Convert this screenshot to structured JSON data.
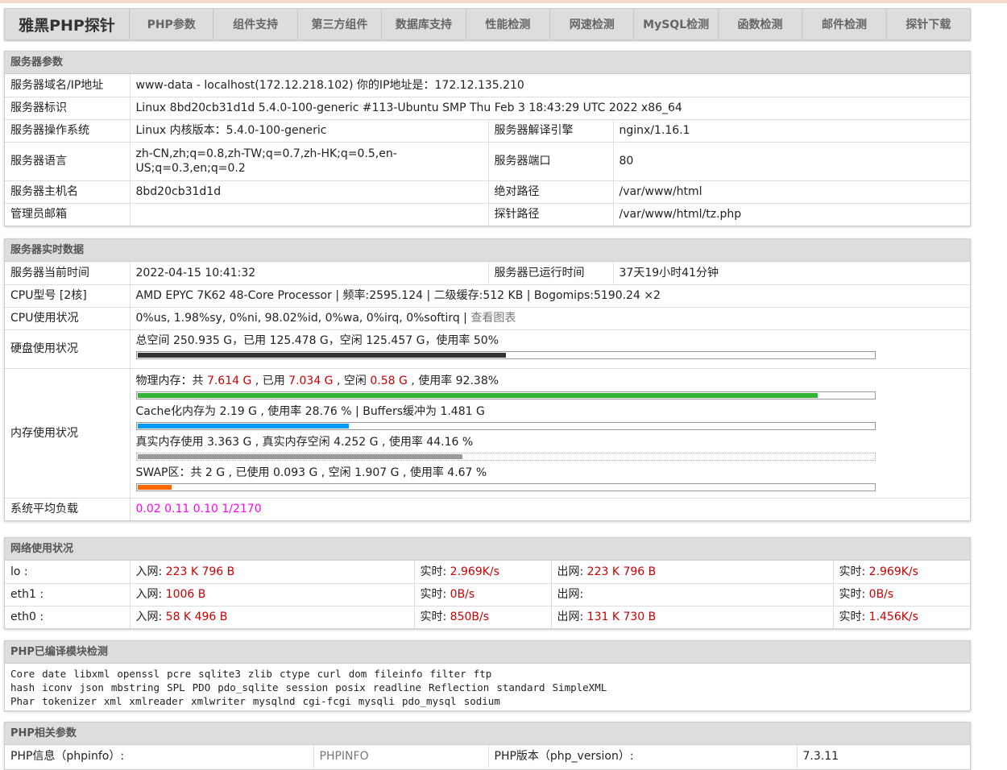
{
  "nav": {
    "logo": "雅黑PHP探针",
    "items": [
      "PHP参数",
      "组件支持",
      "第三方组件",
      "数据库支持",
      "性能检测",
      "网速检测",
      "MySQL检测",
      "函数检测",
      "邮件检测",
      "探针下载"
    ]
  },
  "server": {
    "title": "服务器参数",
    "rows": [
      [
        {
          "t": "服务器域名/IP地址"
        },
        {
          "t": "www-data - localhost(172.12.218.102)  你的IP地址是：172.12.135.210",
          "span": 3
        }
      ],
      [
        {
          "t": "服务器标识"
        },
        {
          "t": "Linux 8bd20cb31d1d 5.4.0-100-generic #113-Ubuntu SMP Thu Feb 3 18:43:29 UTC 2022 x86_64",
          "span": 3
        }
      ],
      [
        {
          "t": "服务器操作系统"
        },
        {
          "t": "Linux  内核版本：5.4.0-100-generic"
        },
        {
          "t": "服务器解译引擎"
        },
        {
          "t": "nginx/1.16.1"
        }
      ],
      [
        {
          "t": "服务器语言"
        },
        {
          "t": "zh-CN,zh;q=0.8,zh-TW;q=0.7,zh-HK;q=0.5,en-US;q=0.3,en;q=0.2"
        },
        {
          "t": "服务器端口"
        },
        {
          "t": "80"
        }
      ],
      [
        {
          "t": "服务器主机名"
        },
        {
          "t": "8bd20cb31d1d"
        },
        {
          "t": "绝对路径"
        },
        {
          "t": "/var/www/html"
        }
      ],
      [
        {
          "t": "管理员邮箱"
        },
        {
          "t": ""
        },
        {
          "t": "探针路径"
        },
        {
          "t": "/var/www/html/tz.php"
        }
      ]
    ]
  },
  "realtime": {
    "title": "服务器实时数据",
    "time_label": "服务器当前时间",
    "time": "2022-04-15 10:41:32",
    "uptime_label": "服务器已运行时间",
    "uptime": "37天19小时41分钟",
    "cpu_label": "CPU型号 [2核]",
    "cpu": "AMD EPYC 7K62 48-Core Processor | 频率:2595.124 | 二级缓存:512 KB | Bogomips:5190.24 ×2",
    "cpu_usage_label": "CPU使用状况",
    "cpu_usage": "0%us, 1.98%sy, 0%ni, 98.02%id, 0%wa, 0%irq, 0%softirq | ",
    "cpu_chart_link": "查看图表",
    "disk_label": "硬盘使用状况",
    "disk": "总空间 250.935 G，已用 125.478 G，空闲 125.457 G，使用率 50%",
    "disk_pct": 50,
    "mem_label": "内存使用状况",
    "mem": [
      {
        "parts": [
          {
            "t": "物理内存：共 "
          },
          {
            "t": "7.614 G",
            "red": true
          },
          {
            "t": " , 已用 "
          },
          {
            "t": "7.034 G",
            "red": true
          },
          {
            "t": " , 空闲 "
          },
          {
            "t": "0.58 G",
            "red": true
          },
          {
            "t": " , 使用率 92.38%"
          }
        ],
        "pct": 92.38,
        "color": "#33b333"
      },
      {
        "parts": [
          {
            "t": "Cache化内存为 2.19 G , 使用率 28.76 % | Buffers缓冲为 1.481 G"
          }
        ],
        "pct": 28.76,
        "color": "#0099ff"
      },
      {
        "parts": [
          {
            "t": "真实内存使用 3.363 G , 真实内存空闲 4.252 G , 使用率 44.16 %"
          }
        ],
        "pct": 44.16,
        "color": "#999999",
        "dotted": true
      },
      {
        "parts": [
          {
            "t": "SWAP区：共 2 G , 已使用 0.093 G , 空闲 1.907 G , 使用率 4.67 %"
          }
        ],
        "pct": 4.67,
        "color": "#ff6600"
      }
    ],
    "load_label": "系统平均负载",
    "load": "0.02 0.11 0.10 1/2170",
    "disk_color": "#333333"
  },
  "network": {
    "title": "网络使用状况",
    "rows": [
      {
        "name": "lo :",
        "in_label": "入网: ",
        "in": "223 K 796 B",
        "rt_label": "实时: ",
        "rt_in": "2.969K/s",
        "out_label": "出网: ",
        "out": "223 K 796 B",
        "rt_out": "2.969K/s"
      },
      {
        "name": "eth1 :",
        "in_label": "入网: ",
        "in": "1006 B",
        "rt_label": "实时: ",
        "rt_in": "0B/s",
        "out_label": "出网: ",
        "out": "",
        "rt_out": "0B/s"
      },
      {
        "name": "eth0 :",
        "in_label": "入网: ",
        "in": "58 K 496 B",
        "rt_label": "实时: ",
        "rt_in": "850B/s",
        "out_label": "出网: ",
        "out": "131 K 730 B",
        "rt_out": "1.456K/s"
      }
    ]
  },
  "modules": {
    "title": "PHP已编译模块检测",
    "lines": [
      [
        "Core",
        "date",
        "libxml",
        "openssl",
        "pcre",
        "sqlite3",
        "zlib",
        "ctype",
        "curl",
        "dom",
        "fileinfo",
        "filter",
        "ftp"
      ],
      [
        "hash",
        "iconv",
        "json",
        "mbstring",
        "SPL",
        "PDO",
        "pdo_sqlite",
        "session",
        "posix",
        "readline",
        "Reflection",
        "standard",
        "SimpleXML"
      ],
      [
        "Phar",
        "tokenizer",
        "xml",
        "xmlreader",
        "xmlwriter",
        "mysqlnd",
        "cgi-fcgi",
        "mysqli",
        "pdo_mysql",
        "sodium"
      ]
    ]
  },
  "phpparams": {
    "title": "PHP相关参数",
    "phpinfo_label": "PHP信息（phpinfo）:",
    "phpinfo_link": "PHPINFO",
    "version_label": "PHP版本（php_version）:",
    "version": "7.3.11"
  }
}
